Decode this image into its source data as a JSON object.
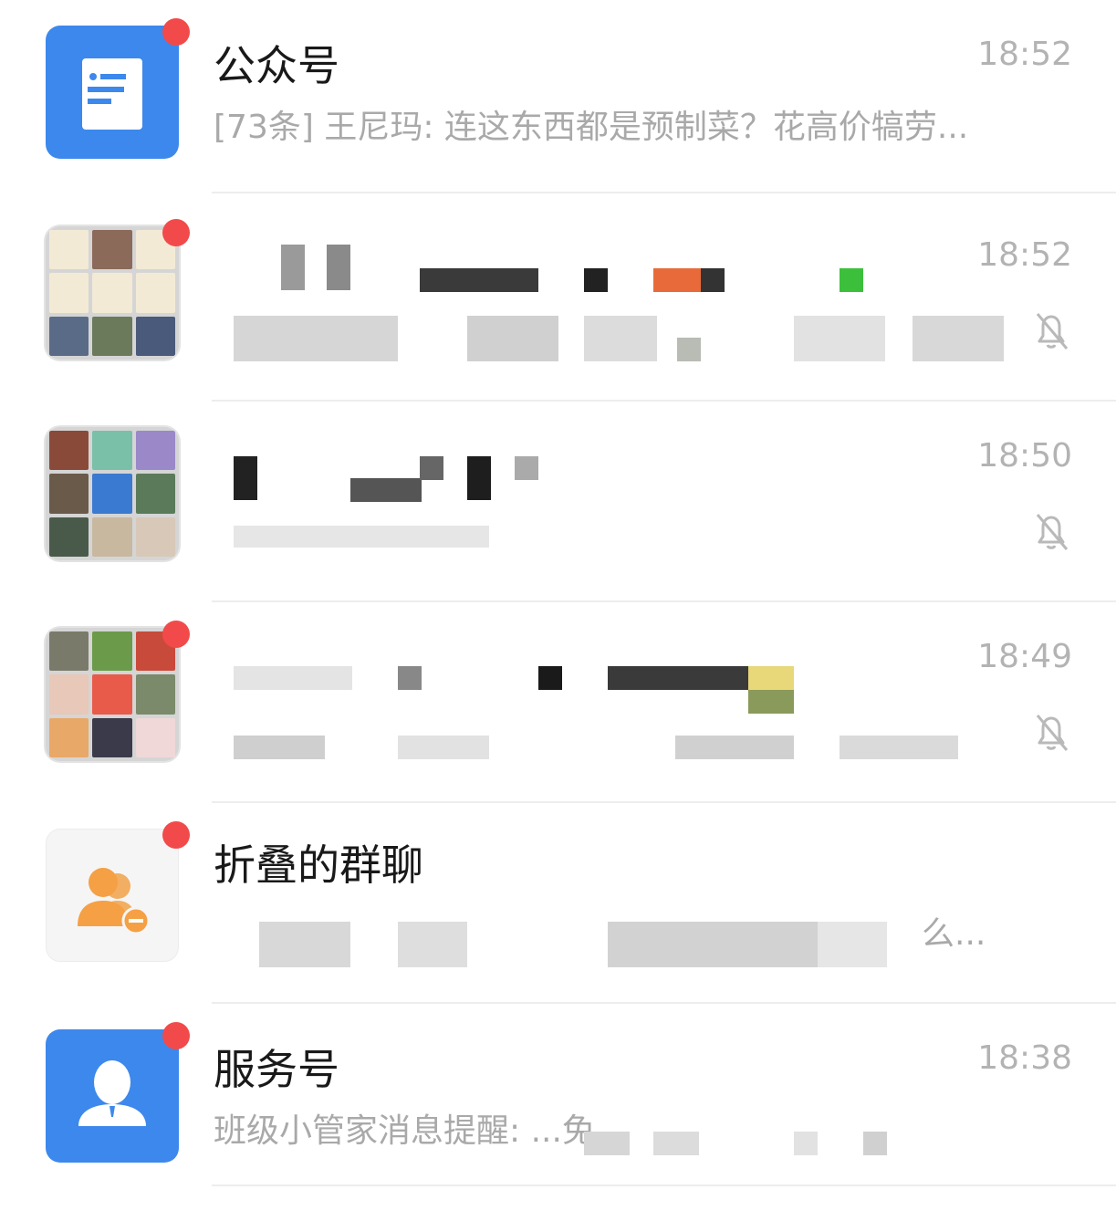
{
  "chats": [
    {
      "name": "公众号",
      "time": "18:52",
      "preview": "[73条] 王尼玛: 连这东西都是预制菜？花高价犒劳...",
      "avatar_icon": "article-icon",
      "unread": true,
      "muted": false
    },
    {
      "name": "",
      "time": "18:52",
      "preview": "",
      "avatar_icon": "group-grid-avatar",
      "unread": true,
      "muted": true
    },
    {
      "name": "",
      "time": "18:50",
      "preview": "",
      "avatar_icon": "group-grid-avatar",
      "unread": false,
      "muted": true
    },
    {
      "name": "",
      "time": "18:49",
      "preview": "",
      "avatar_icon": "group-grid-avatar",
      "unread": true,
      "muted": true
    },
    {
      "name": "折叠的群聊",
      "time": "",
      "preview": "么...",
      "avatar_icon": "folded-group-icon",
      "unread": true,
      "muted": false
    },
    {
      "name": "服务号",
      "time": "18:38",
      "preview": "班级小管家消息提醒: ...免...",
      "avatar_icon": "service-account-icon",
      "unread": true,
      "muted": false
    }
  ],
  "colors": {
    "accent_blue": "#3d88ec",
    "unread_red": "#f24a4a",
    "folded_orange": "#f5a044"
  }
}
